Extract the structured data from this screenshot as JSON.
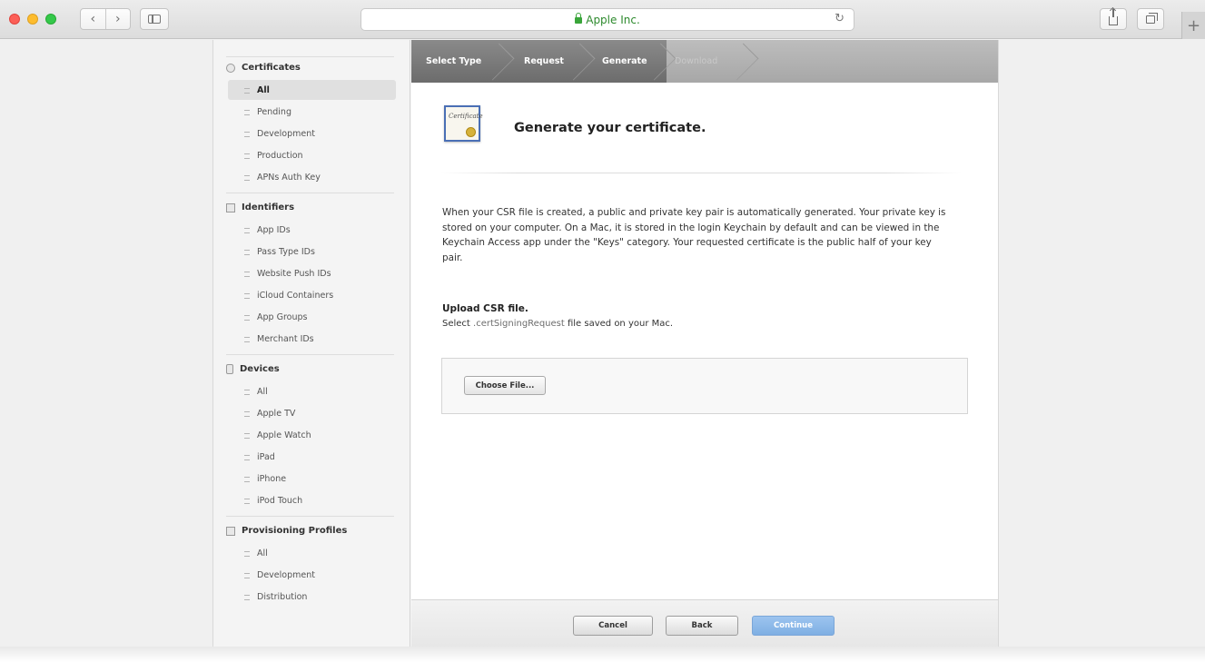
{
  "browser": {
    "address_text": "Apple Inc.",
    "nav_back": "‹",
    "nav_forward": "›",
    "reload_glyph": "↻",
    "new_tab_glyph": "+"
  },
  "sidebar": {
    "sections": [
      {
        "title": "Certificates",
        "icon": "certificate-icon",
        "items": [
          "All",
          "Pending",
          "Development",
          "Production",
          "APNs Auth Key"
        ],
        "active": "All"
      },
      {
        "title": "Identifiers",
        "icon": "identifier-icon",
        "items": [
          "App IDs",
          "Pass Type IDs",
          "Website Push IDs",
          "iCloud Containers",
          "App Groups",
          "Merchant IDs"
        ]
      },
      {
        "title": "Devices",
        "icon": "device-icon",
        "items": [
          "All",
          "Apple TV",
          "Apple Watch",
          "iPad",
          "iPhone",
          "iPod Touch"
        ]
      },
      {
        "title": "Provisioning Profiles",
        "icon": "profile-icon",
        "items": [
          "All",
          "Development",
          "Distribution"
        ]
      }
    ]
  },
  "steps": [
    "Select Type",
    "Request",
    "Generate",
    "Download"
  ],
  "current_step": "Generate",
  "main": {
    "badge_script": "Certificate",
    "title": "Generate your certificate.",
    "description": "When your CSR file is created, a public and private key pair is automatically generated. Your private key is stored on your computer. On a Mac, it is stored in the login Keychain by default and can be viewed in the Keychain Access app under the \"Keys\" category. Your requested certificate is the public half of your key pair.",
    "upload_heading": "Upload CSR file.",
    "upload_sub_prefix": "Select ",
    "upload_sub_code": ".certSigningRequest",
    "upload_sub_suffix": " file saved on your Mac.",
    "choose_file_label": "Choose File..."
  },
  "footer": {
    "cancel_label": "Cancel",
    "back_label": "Back",
    "continue_label": "Continue"
  },
  "colors": {
    "continue_button": "#8fb9e9",
    "steps_bar": "#7a7a7a",
    "secure_text": "#2d8a2d"
  }
}
